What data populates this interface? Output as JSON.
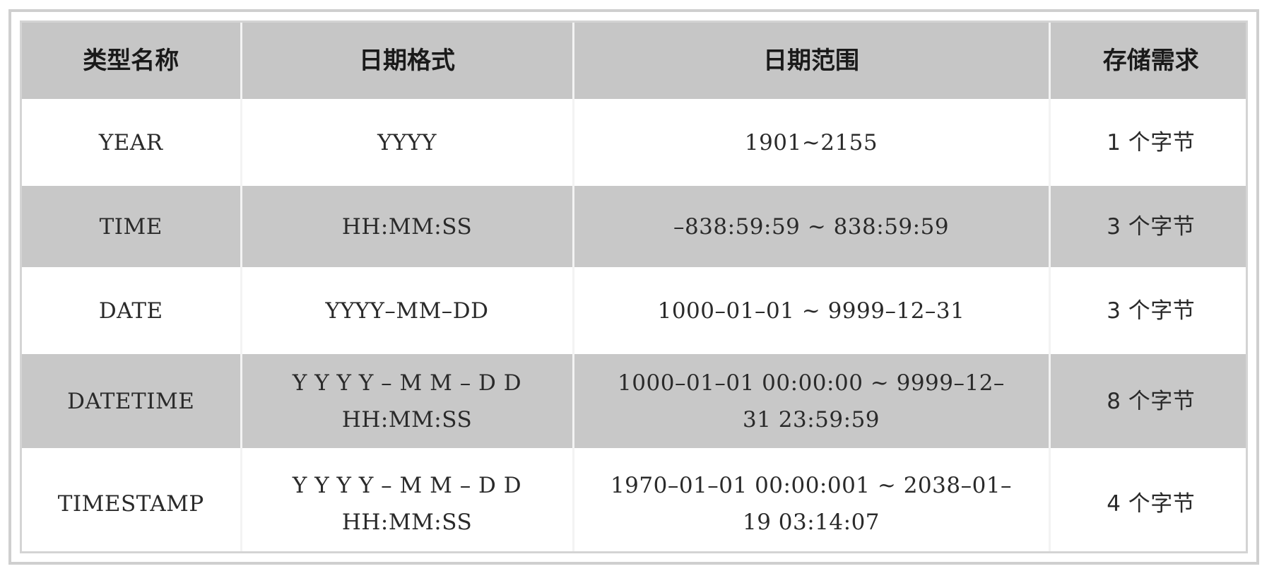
{
  "table": {
    "headers": [
      "类型名称",
      "日期格式",
      "日期范围",
      "存储需求"
    ],
    "rows": [
      {
        "type": "YEAR",
        "format": [
          "YYYY"
        ],
        "range": [
          "1901~2155"
        ],
        "storage": "1 个字节"
      },
      {
        "type": "TIME",
        "format": [
          "HH:MM:SS"
        ],
        "range": [
          "–838:59:59 ~ 838:59:59"
        ],
        "storage": "3 个字节"
      },
      {
        "type": "DATE",
        "format": [
          "YYYY–MM–DD"
        ],
        "range": [
          "1000–01–01 ~ 9999–12–31"
        ],
        "storage": "3 个字节"
      },
      {
        "type": "DATETIME",
        "format": [
          "Y Y Y Y – M M – D D",
          "HH:MM:SS"
        ],
        "range": [
          "1000–01–01 00:00:00 ~ 9999–12–",
          "31 23:59:59"
        ],
        "storage": "8 个字节"
      },
      {
        "type": "TIMESTAMP",
        "format": [
          "Y Y Y Y – M M – D D",
          "HH:MM:SS"
        ],
        "range": [
          "1970–01–01 00:00:001 ~ 2038–01–",
          "19 03:14:07"
        ],
        "storage": "4 个字节"
      }
    ]
  }
}
